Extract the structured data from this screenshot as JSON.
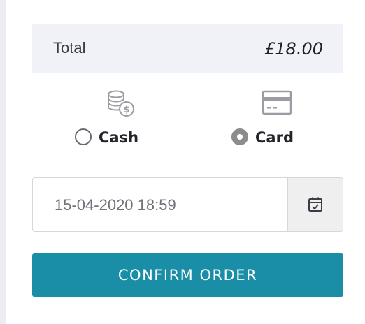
{
  "summary": {
    "total_label": "Total",
    "total_value": "£18.00"
  },
  "payment": {
    "options": [
      {
        "label": "Cash",
        "icon": "coins-icon",
        "selected": false
      },
      {
        "label": "Card",
        "icon": "credit-card-icon",
        "selected": true
      }
    ]
  },
  "datetime": {
    "value": "15-04-2020 18:59",
    "icon": "calendar-icon"
  },
  "confirm": {
    "label": "CONFIRM ORDER"
  },
  "colors": {
    "accent": "#198ea6",
    "panel": "#f1f2f7",
    "icon_gray": "#9b9da3"
  }
}
